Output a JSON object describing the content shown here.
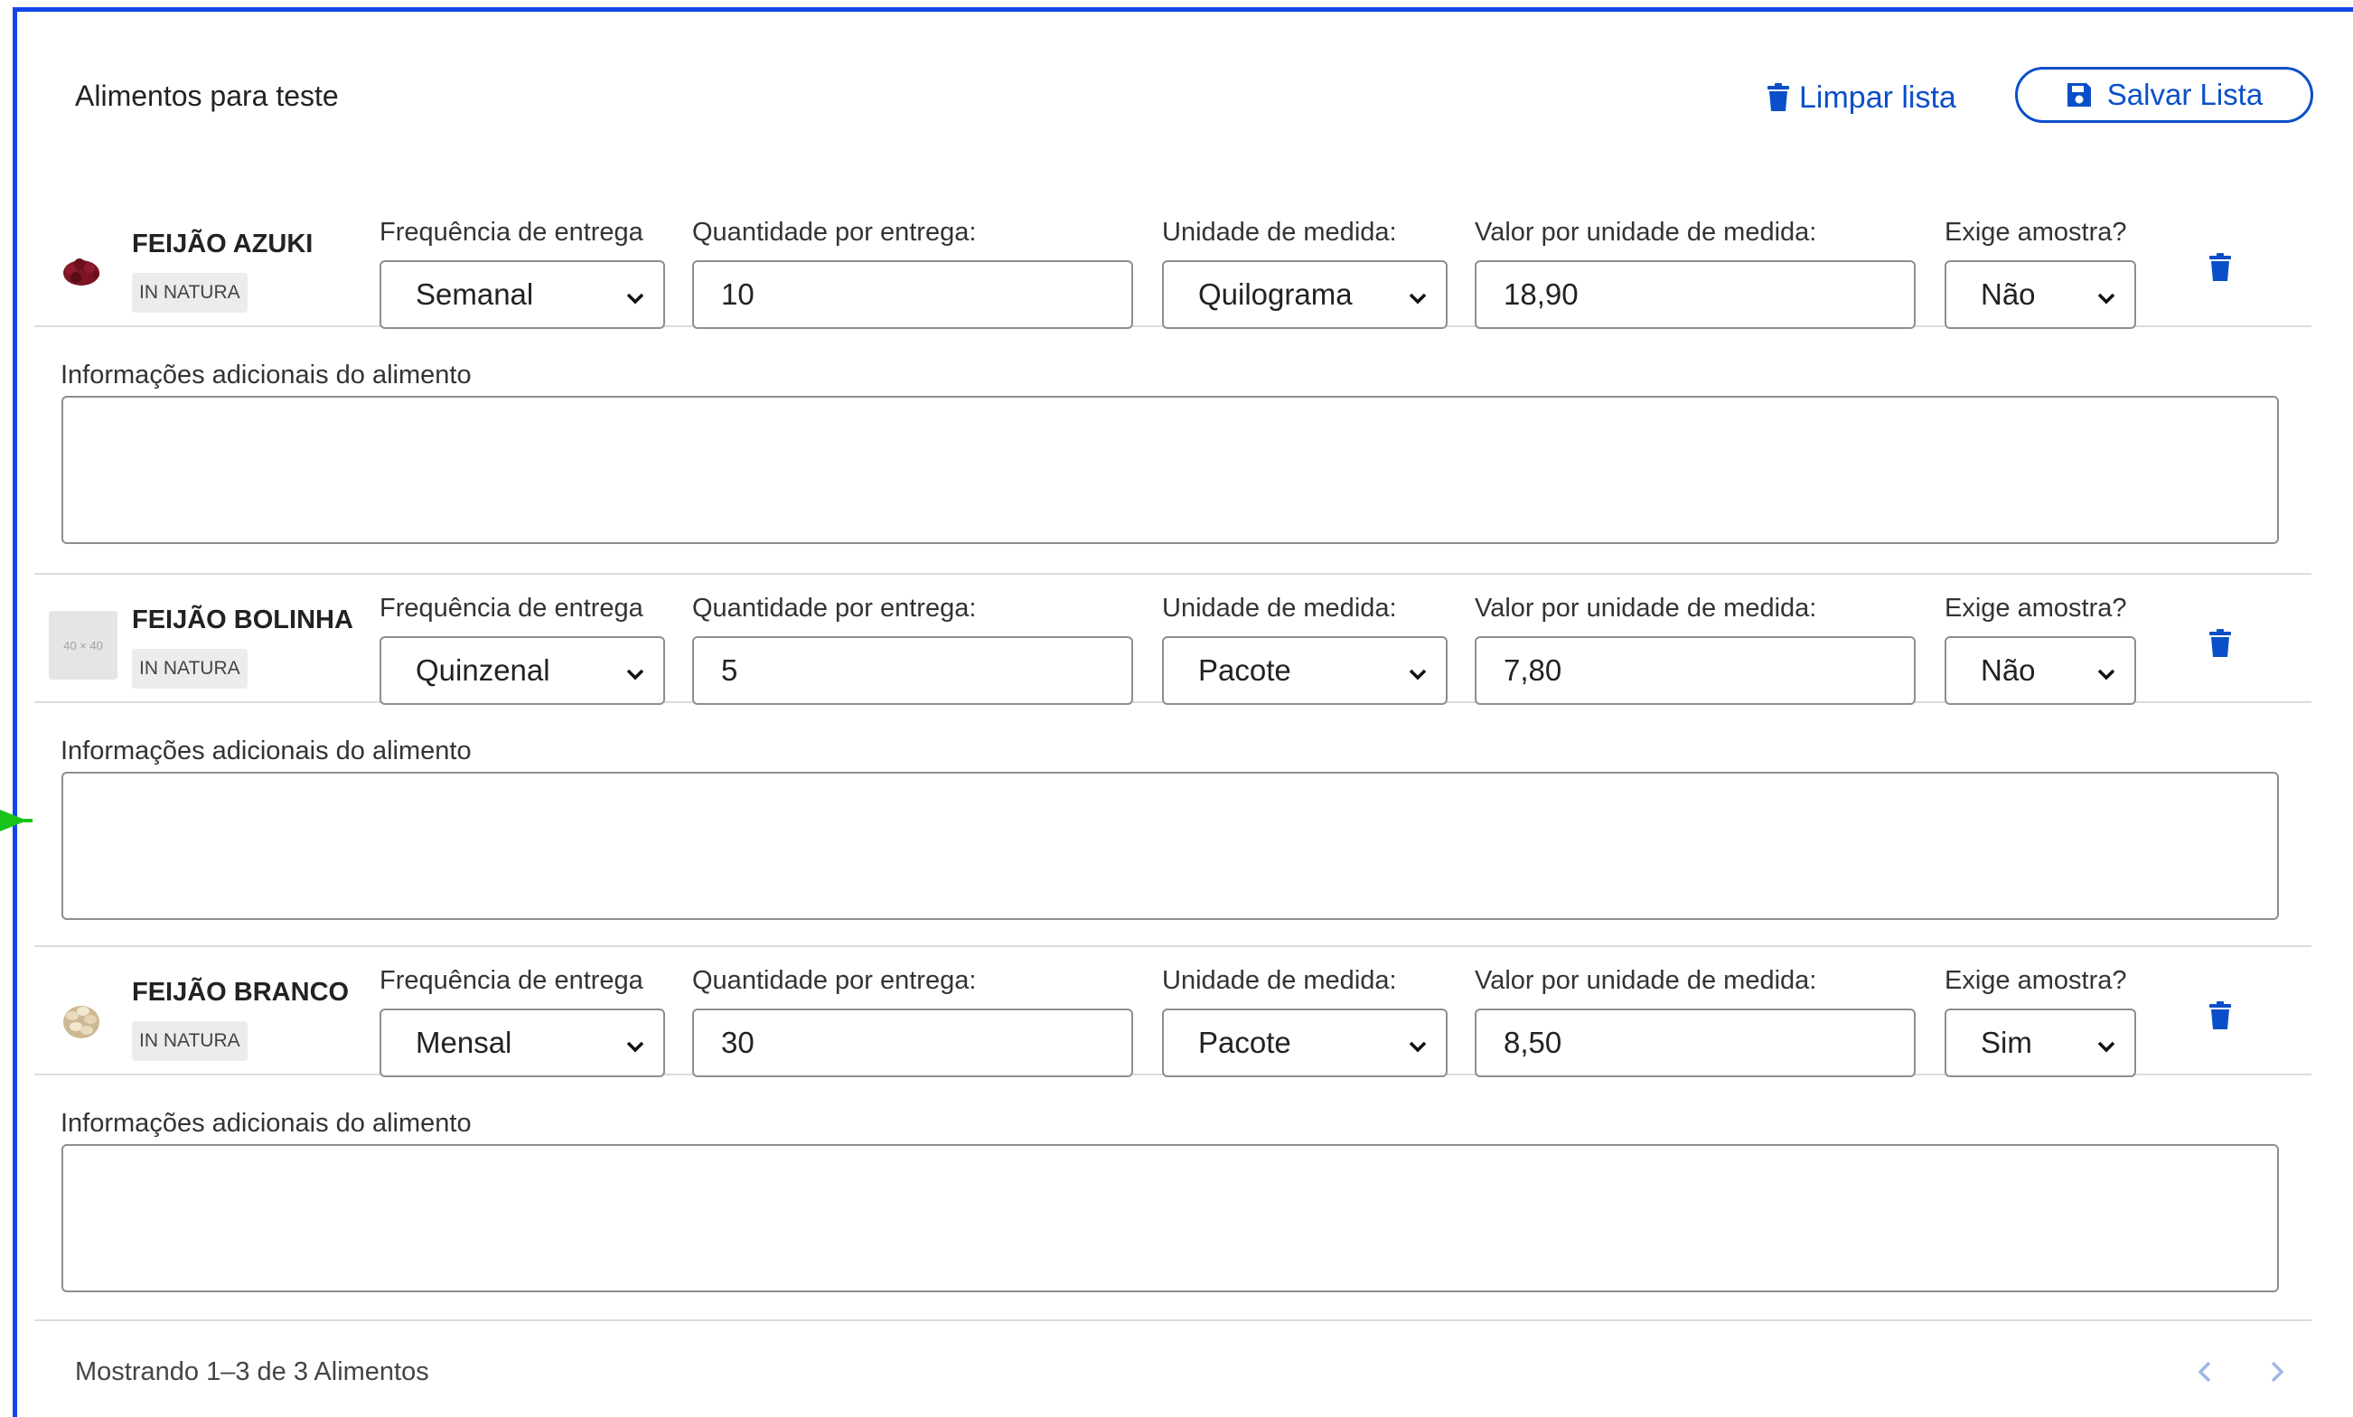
{
  "header": {
    "title": "Alimentos para teste",
    "clear_label": "Limpar lista",
    "save_label": "Salvar Lista"
  },
  "labels": {
    "frequency": "Frequência de entrega",
    "quantity": "Quantidade por entrega:",
    "unit": "Unidade de medida:",
    "value": "Valor por unidade de medida:",
    "sample": "Exige amostra?",
    "info": "Informações adicionais do alimento"
  },
  "foods": [
    {
      "name": "FEIJÃO AZUKI",
      "badge": "IN NATURA",
      "image": "azuki-bean-image",
      "frequency": "Semanal",
      "quantity": "10",
      "unit": "Quilograma",
      "value": "18,90",
      "sample": "Não",
      "info": ""
    },
    {
      "name": "FEIJÃO BOLINHA",
      "badge": "IN NATURA",
      "image": "placeholder-image",
      "placeholder_text": "40 × 40",
      "frequency": "Quinzenal",
      "quantity": "5",
      "unit": "Pacote",
      "value": "7,80",
      "sample": "Não",
      "info": ""
    },
    {
      "name": "FEIJÃO BRANCO",
      "badge": "IN NATURA",
      "image": "white-bean-image",
      "frequency": "Mensal",
      "quantity": "30",
      "unit": "Pacote",
      "value": "8,50",
      "sample": "Sim",
      "info": ""
    }
  ],
  "footer": {
    "status_text": "Mostrando  1–3 de 3 Alimentos",
    "prev_icon": "chevron-left-icon",
    "next_icon": "chevron-right-icon"
  },
  "colors": {
    "accent": "#0b4fc8",
    "frame": "#1246e8",
    "marker": "#19c319",
    "border": "#8e8e8e",
    "divider": "#dcdcdc"
  }
}
